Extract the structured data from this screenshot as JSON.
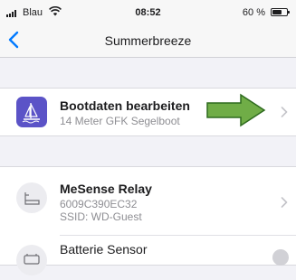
{
  "status_bar": {
    "carrier": "Blau",
    "time": "08:52",
    "battery_percent": "60 %",
    "battery_level": 0.6,
    "icons": [
      "signal-icon",
      "wifi-icon",
      "battery-icon"
    ]
  },
  "nav": {
    "title": "Summerbreeze",
    "back_icon": "chevron-left-icon"
  },
  "sections": [
    {
      "rows": [
        {
          "title": "Bootdaten bearbeiten",
          "subtitle": "14 Meter GFK Segelboot",
          "icon": "sailboat-icon",
          "accessory": "chevron-right-icon",
          "annotation": "green-arrow-icon"
        }
      ]
    },
    {
      "rows": [
        {
          "title": "MeSense Relay",
          "subtitle": "6009C390EC32",
          "subtitle2": "SSID: WD-Guest",
          "icon": "relay-device-icon",
          "accessory": "chevron-right-icon"
        },
        {
          "title": "Batterie Sensor",
          "icon": "battery-sensor-icon",
          "accessory": "disclosure-icon"
        }
      ]
    }
  ],
  "colors": {
    "accent": "#007aff",
    "icon_background": "#5b53c7",
    "arrow_fill": "#70ad47",
    "arrow_stroke": "#2e6b1f",
    "background": "#f2f2f7"
  }
}
